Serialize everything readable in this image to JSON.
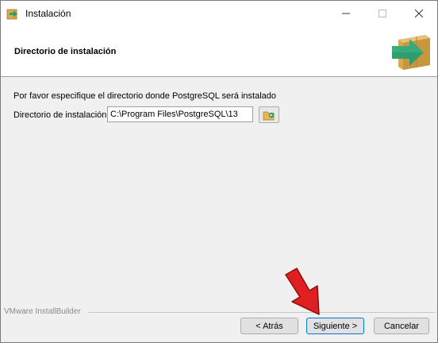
{
  "window": {
    "title": "Instalación",
    "icon": "installer-app-icon",
    "controls": [
      "minimize-icon",
      "maximize-icon",
      "close-icon"
    ]
  },
  "header": {
    "title": "Directorio de instalación",
    "logo": "install-arrow-box-icon"
  },
  "body": {
    "instruction": "Por favor especifique el directorio donde PostgreSQL será instalado",
    "directory_label": "Directorio de instalación",
    "directory_value": "C:\\Program Files\\PostgreSQL\\13",
    "browse_icon": "folder-browse-icon"
  },
  "footer": {
    "brand": "VMware InstallBuilder",
    "back_label": "< Atrás",
    "next_label": "Siguiente >",
    "cancel_label": "Cancelar"
  },
  "overlay": {
    "arrow": "red-pointer-arrow-icon"
  },
  "colors": {
    "accent": "#0078d7",
    "logo_green": "#2e9e6e",
    "logo_box": "#d9a94a",
    "arrow_red": "#e02020"
  }
}
